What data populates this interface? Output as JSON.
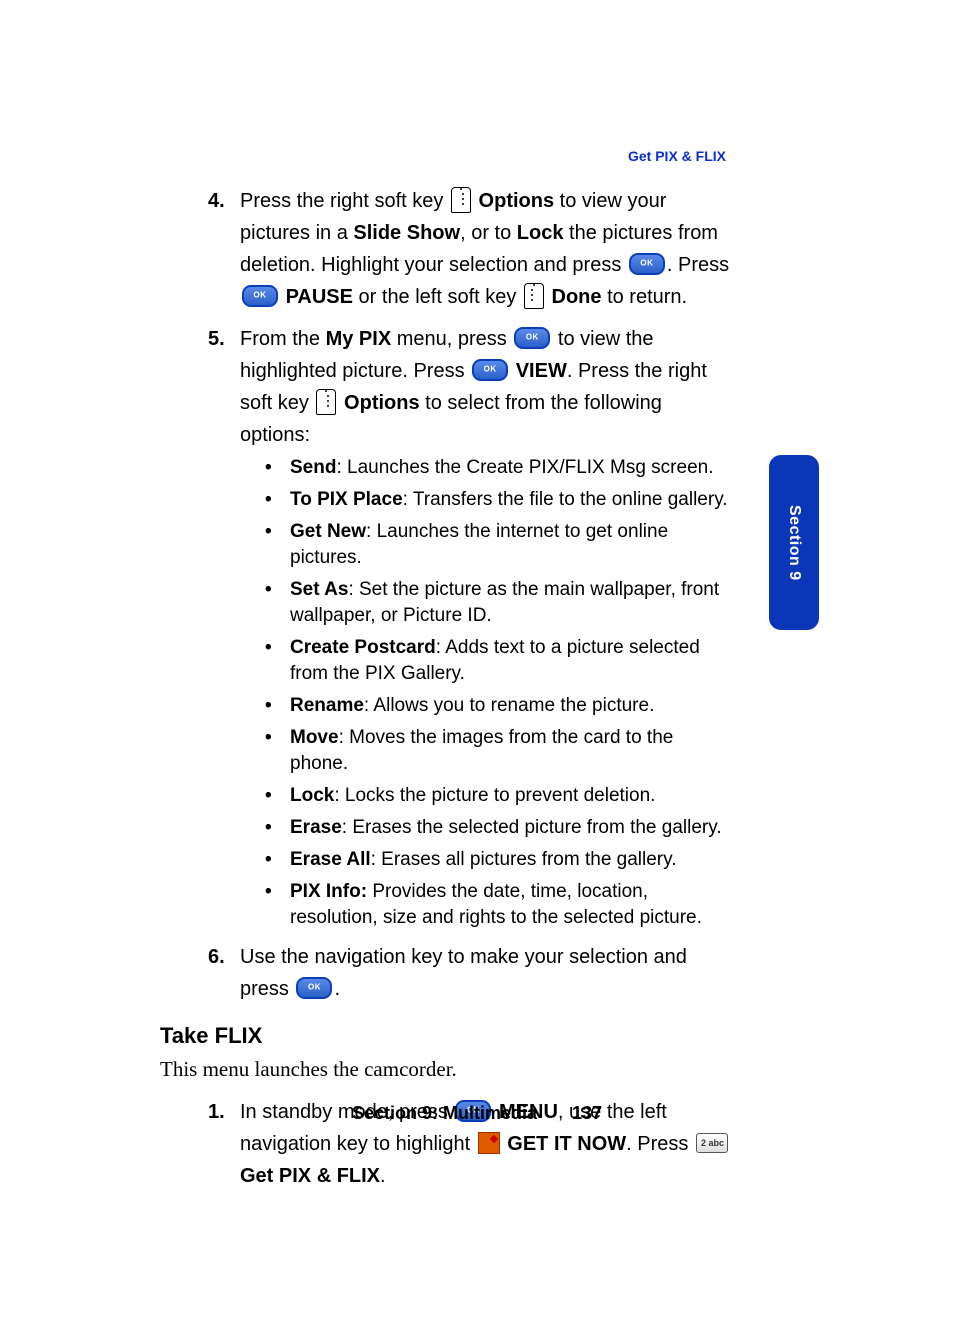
{
  "header": {
    "link": "Get PIX & FLIX"
  },
  "steps": {
    "four": {
      "pre1": "Press the right soft key ",
      "options": "Options",
      "mid1": " to view your pictures in a ",
      "slideshow": "Slide Show",
      "mid2": ", or to ",
      "lock": "Lock",
      "mid3": " the pictures from deletion. Highlight your selection and press ",
      "mid4": ". Press ",
      "pause": "PAUSE",
      "mid5": " or the left soft key ",
      "done": "Done",
      "end": " to return."
    },
    "five": {
      "pre1": "From the ",
      "mypix": "My PIX",
      "mid1": " menu, press ",
      "mid2": " to view the highlighted picture. Press ",
      "view": "VIEW",
      "mid3": ". Press the right soft key ",
      "options": "Options",
      "end": " to select from the following options:"
    },
    "six": {
      "pre": "Use the navigation key to make your selection and press ",
      "end": "."
    }
  },
  "bullets": [
    {
      "label": "Send",
      "desc": ": Launches the Create PIX/FLIX Msg screen."
    },
    {
      "label": "To PIX Place",
      "desc": ": Transfers the file to the online gallery."
    },
    {
      "label": "Get New",
      "desc": ": Launches the internet to get online pictures."
    },
    {
      "label": "Set As",
      "desc": ": Set the picture as the main wallpaper, front wallpaper, or Picture ID."
    },
    {
      "label": "Create Postcard",
      "desc": ": Adds text to a picture selected from the PIX Gallery."
    },
    {
      "label": "Rename",
      "desc": ": Allows you to rename the picture."
    },
    {
      "label": "Move",
      "desc": ": Moves the images from the card to the phone."
    },
    {
      "label": "Lock",
      "desc": ": Locks the picture to prevent deletion."
    },
    {
      "label": "Erase",
      "desc": ": Erases the selected picture from the gallery."
    },
    {
      "label": "Erase All",
      "desc": ": Erases all pictures from the gallery."
    },
    {
      "label": "PIX Info:",
      "desc": " Provides the date, time, location, resolution, size and rights to the selected picture."
    }
  ],
  "takeflix": {
    "heading": "Take FLIX",
    "intro": "This menu launches the camcorder.",
    "step1": {
      "pre1": "In standby mode, press ",
      "menu": "MENU",
      "mid1": ", use the left navigation key to highlight ",
      "getitnow": "GET IT NOW",
      "mid2": ". Press ",
      "getpix": "Get PIX & FLIX",
      "end": "."
    }
  },
  "tab": {
    "label": "Section 9"
  },
  "footer": {
    "section": "Section 9: Multimedia",
    "page": "137"
  },
  "icons": {
    "numkey2": "2 abc"
  }
}
